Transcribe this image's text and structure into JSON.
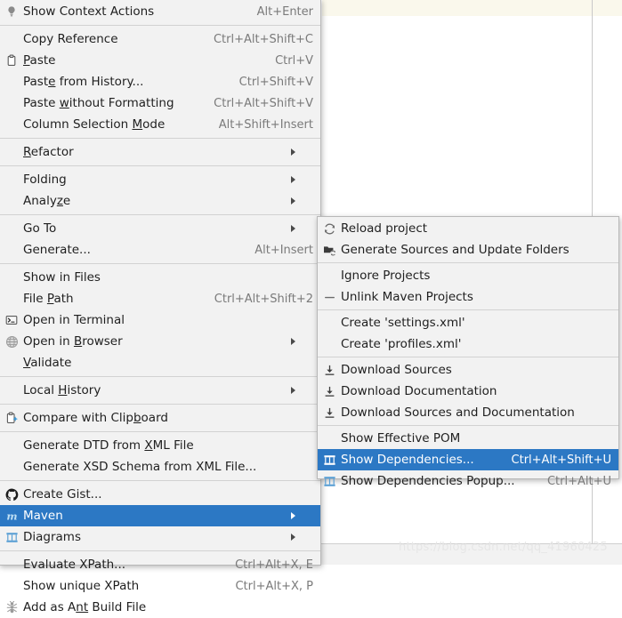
{
  "colors": {
    "menu_bg": "#f2f2f2",
    "menu_border": "#b8b8b8",
    "selection_blue": "#2c78c4",
    "text": "#1f1f1f",
    "accel_text": "#7a7a7a",
    "separator": "#d2d2d2",
    "editor_highlight_line": "#faf8ec",
    "margin_guide": "#c9c9c9",
    "watermark": "#e6e6e6",
    "maven_icon_blue": "#3a9fd8",
    "diagram_icon_blue": "#5a9fd4"
  },
  "editor": {
    "watermark": "https://blog.csdn.net/qq_41960425"
  },
  "context_menu": {
    "name": "editor-context-menu",
    "items": [
      {
        "type": "item",
        "label": "Show Context Actions",
        "mnemonic": "",
        "accel": "Alt+Enter",
        "icon": "lightbulb-icon",
        "submenu": false,
        "selected": false
      },
      {
        "type": "separator"
      },
      {
        "type": "item",
        "label": "Copy Reference",
        "mnemonic": "",
        "accel": "Ctrl+Alt+Shift+C",
        "icon": "",
        "submenu": false,
        "selected": false
      },
      {
        "type": "item",
        "label": "Paste",
        "mnemonic": "P",
        "accel": "Ctrl+V",
        "icon": "clipboard-icon",
        "submenu": false,
        "selected": false
      },
      {
        "type": "item",
        "label": "Paste from History...",
        "mnemonic": "e",
        "accel": "Ctrl+Shift+V",
        "icon": "",
        "submenu": false,
        "selected": false
      },
      {
        "type": "item",
        "label": "Paste without Formatting",
        "mnemonic": "w",
        "accel": "Ctrl+Alt+Shift+V",
        "icon": "",
        "submenu": false,
        "selected": false
      },
      {
        "type": "item",
        "label": "Column Selection Mode",
        "mnemonic": "M",
        "accel": "Alt+Shift+Insert",
        "icon": "",
        "submenu": false,
        "selected": false
      },
      {
        "type": "separator"
      },
      {
        "type": "item",
        "label": "Refactor",
        "mnemonic": "R",
        "accel": "",
        "icon": "",
        "submenu": true,
        "selected": false
      },
      {
        "type": "separator"
      },
      {
        "type": "item",
        "label": "Folding",
        "mnemonic": "",
        "accel": "",
        "icon": "",
        "submenu": true,
        "selected": false
      },
      {
        "type": "item",
        "label": "Analyze",
        "mnemonic": "z",
        "accel": "",
        "icon": "",
        "submenu": true,
        "selected": false
      },
      {
        "type": "separator"
      },
      {
        "type": "item",
        "label": "Go To",
        "mnemonic": "",
        "accel": "",
        "icon": "",
        "submenu": true,
        "selected": false
      },
      {
        "type": "item",
        "label": "Generate...",
        "mnemonic": "",
        "accel": "Alt+Insert",
        "icon": "",
        "submenu": false,
        "selected": false
      },
      {
        "type": "separator"
      },
      {
        "type": "item",
        "label": "Show in Files",
        "mnemonic": "",
        "accel": "",
        "icon": "",
        "submenu": false,
        "selected": false
      },
      {
        "type": "item",
        "label": "File Path",
        "mnemonic": "P",
        "accel": "Ctrl+Alt+Shift+2",
        "icon": "",
        "submenu": false,
        "selected": false
      },
      {
        "type": "item",
        "label": "Open in Terminal",
        "mnemonic": "",
        "accel": "",
        "icon": "terminal-icon",
        "submenu": false,
        "selected": false
      },
      {
        "type": "item",
        "label": "Open in Browser",
        "mnemonic": "B",
        "accel": "",
        "icon": "globe-icon",
        "submenu": true,
        "selected": false
      },
      {
        "type": "item",
        "label": "Validate",
        "mnemonic": "V",
        "accel": "",
        "icon": "",
        "submenu": false,
        "selected": false
      },
      {
        "type": "separator"
      },
      {
        "type": "item",
        "label": "Local History",
        "mnemonic": "H",
        "accel": "",
        "icon": "",
        "submenu": true,
        "selected": false
      },
      {
        "type": "separator"
      },
      {
        "type": "item",
        "label": "Compare with Clipboard",
        "mnemonic": "b",
        "accel": "",
        "icon": "compare-clipboard-icon",
        "submenu": false,
        "selected": false
      },
      {
        "type": "separator"
      },
      {
        "type": "item",
        "label": "Generate DTD from XML File",
        "mnemonic": "X",
        "accel": "",
        "icon": "",
        "submenu": false,
        "selected": false
      },
      {
        "type": "item",
        "label": "Generate XSD Schema from XML File...",
        "mnemonic": "",
        "accel": "",
        "icon": "",
        "submenu": false,
        "selected": false
      },
      {
        "type": "separator"
      },
      {
        "type": "item",
        "label": "Create Gist...",
        "mnemonic": "",
        "accel": "",
        "icon": "github-icon",
        "submenu": false,
        "selected": false
      },
      {
        "type": "item",
        "label": "Maven",
        "mnemonic": "",
        "accel": "",
        "icon": "maven-icon",
        "submenu": true,
        "selected": true
      },
      {
        "type": "item",
        "label": "Diagrams",
        "mnemonic": "",
        "accel": "",
        "icon": "diagram-icon",
        "submenu": true,
        "selected": false
      },
      {
        "type": "separator"
      },
      {
        "type": "item",
        "label": "Evaluate XPath...",
        "mnemonic": "",
        "accel": "Ctrl+Alt+X, E",
        "icon": "",
        "submenu": false,
        "selected": false
      },
      {
        "type": "item",
        "label": "Show unique XPath",
        "mnemonic": "",
        "accel": "Ctrl+Alt+X, P",
        "icon": "",
        "submenu": false,
        "selected": false
      },
      {
        "type": "item",
        "label": "Add as Ant Build File",
        "mnemonic": "nt",
        "accel": "",
        "icon": "ant-icon",
        "submenu": false,
        "selected": false
      }
    ]
  },
  "maven_submenu": {
    "name": "maven-submenu",
    "items": [
      {
        "type": "item",
        "label": "Reload project",
        "accel": "",
        "icon": "reload-icon",
        "submenu": false,
        "selected": false
      },
      {
        "type": "item",
        "label": "Generate Sources and Update Folders",
        "accel": "",
        "icon": "generate-sources-icon",
        "submenu": false,
        "selected": false
      },
      {
        "type": "separator"
      },
      {
        "type": "item",
        "label": "Ignore Projects",
        "accel": "",
        "icon": "",
        "submenu": false,
        "selected": false
      },
      {
        "type": "item",
        "label": "Unlink Maven Projects",
        "accel": "",
        "icon": "unlink-icon",
        "submenu": false,
        "selected": false
      },
      {
        "type": "separator"
      },
      {
        "type": "item",
        "label": "Create 'settings.xml'",
        "accel": "",
        "icon": "",
        "submenu": false,
        "selected": false
      },
      {
        "type": "item",
        "label": "Create 'profiles.xml'",
        "accel": "",
        "icon": "",
        "submenu": false,
        "selected": false
      },
      {
        "type": "separator"
      },
      {
        "type": "item",
        "label": "Download Sources",
        "accel": "",
        "icon": "download-icon",
        "submenu": false,
        "selected": false
      },
      {
        "type": "item",
        "label": "Download Documentation",
        "accel": "",
        "icon": "download-icon",
        "submenu": false,
        "selected": false
      },
      {
        "type": "item",
        "label": "Download Sources and Documentation",
        "accel": "",
        "icon": "download-icon",
        "submenu": false,
        "selected": false
      },
      {
        "type": "separator"
      },
      {
        "type": "item",
        "label": "Show Effective POM",
        "accel": "",
        "icon": "",
        "submenu": false,
        "selected": false
      },
      {
        "type": "item",
        "label": "Show Dependencies...",
        "accel": "Ctrl+Alt+Shift+U",
        "icon": "diagram-icon",
        "submenu": false,
        "selected": true
      },
      {
        "type": "item",
        "label": "Show Dependencies Popup...",
        "accel": "Ctrl+Alt+U",
        "icon": "diagram-icon",
        "submenu": false,
        "selected": false
      }
    ]
  }
}
